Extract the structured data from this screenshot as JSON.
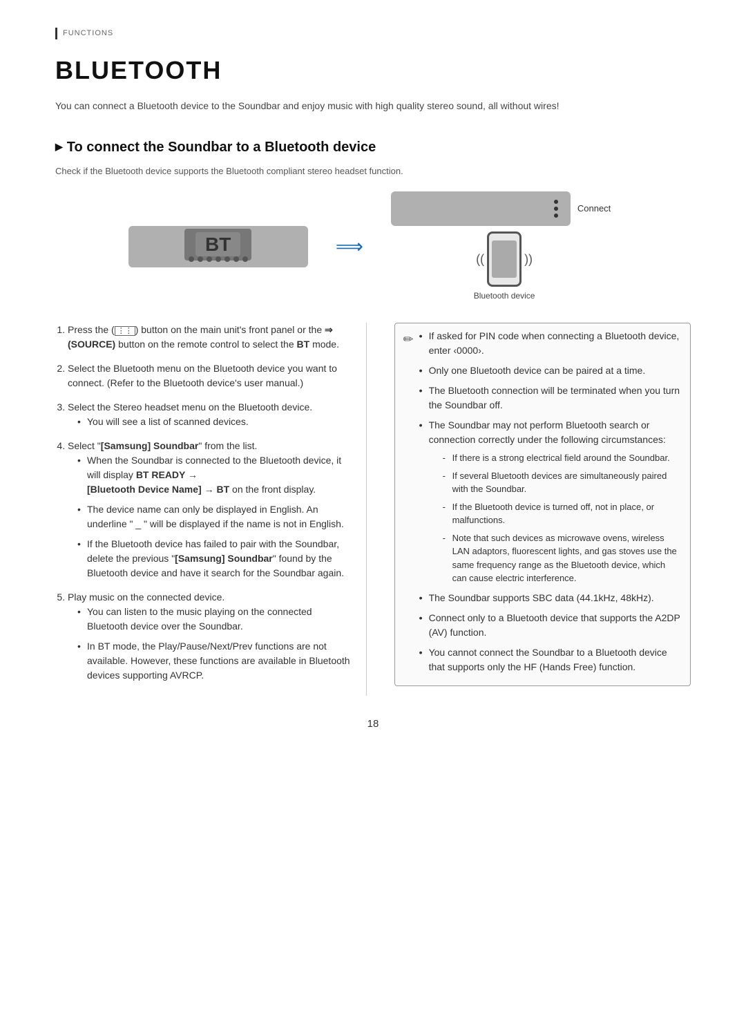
{
  "page": {
    "functions_label": "FUNCTIONS",
    "title": "BLUETOOTH",
    "intro": "You can connect a Bluetooth device to the Soundbar and enjoy music with high quality stereo sound, all without wires!",
    "section_header": "To connect the Soundbar to a Bluetooth device",
    "subtitle": "Check if the Bluetooth device supports the Bluetooth compliant stereo headset function.",
    "diagram": {
      "soundbar_bt": "BT",
      "connect_label": "Connect",
      "bt_device_label": "Bluetooth device"
    },
    "steps": [
      {
        "num": "1",
        "text": "Press the (    ) button on the main unit's front panel or the   (SOURCE) button on the remote control to select the BT mode."
      },
      {
        "num": "2",
        "text": "Select the Bluetooth menu on the Bluetooth device you want to connect. (Refer to the Bluetooth device's user manual.)"
      },
      {
        "num": "3",
        "text": "Select the Stereo headset menu on the Bluetooth device.",
        "bullet": "You will see a list of scanned devices."
      },
      {
        "num": "4",
        "text": "Select \"[Samsung] Soundbar\" from the list.",
        "bullets": [
          "When the Soundbar is connected to the Bluetooth device, it will display BT READY → [Bluetooth Device Name] → BT on the front display.",
          "The device name can only be displayed in English. An underline \" _ \" will be displayed if the name is not in English.",
          "If the Bluetooth device has failed to pair with the Soundbar, delete the previous \"[Samsung] Soundbar\" found by the Bluetooth device and have it search for the Soundbar again."
        ]
      },
      {
        "num": "5",
        "text": "Play music on the connected device.",
        "bullets": [
          "You can listen to the music playing on the connected Bluetooth device over the Soundbar.",
          "In BT mode, the Play/Pause/Next/Prev functions are not available. However, these functions are available in Bluetooth devices supporting AVRCP."
        ]
      }
    ],
    "notes": [
      "If asked for PIN code when connecting a Bluetooth device, enter ‹0000›.",
      "Only one Bluetooth device can be paired at a time.",
      "The Bluetooth connection will be terminated when you turn the Soundbar off.",
      "The Soundbar may not perform Bluetooth search or connection correctly under the following circumstances:",
      "The Soundbar supports SBC data (44.1kHz, 48kHz).",
      "Connect only to a Bluetooth device that supports the A2DP (AV) function.",
      "You cannot connect the Soundbar to a Bluetooth device that supports only the HF (Hands Free) function."
    ],
    "circumstances": [
      "If there is a strong electrical field around the Soundbar.",
      "If several Bluetooth devices are simultaneously paired with the Soundbar.",
      "If the Bluetooth device is turned off, not in place, or malfunctions.",
      "Note that such devices as microwave ovens, wireless LAN adaptors, fluorescent lights, and gas stoves use the same frequency range as the Bluetooth device, which can cause electric interference."
    ],
    "page_number": "18"
  }
}
